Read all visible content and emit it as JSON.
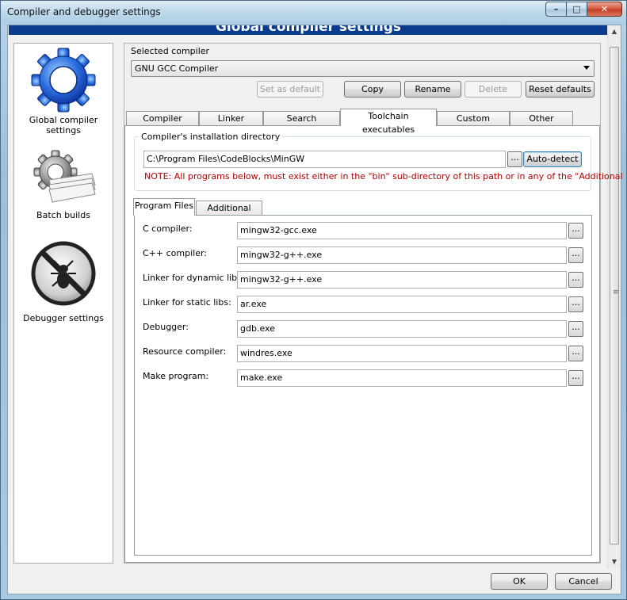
{
  "window": {
    "title": "Compiler and debugger settings",
    "min_glyph": "–",
    "max_glyph": "□",
    "close_glyph": "✕"
  },
  "banner": {
    "title": "Global compiler settings"
  },
  "sidebar": {
    "items": [
      {
        "label": "Global compiler settings",
        "icon": "gear-icon"
      },
      {
        "label": "Batch builds",
        "icon": "batch-gear-icon"
      },
      {
        "label": "Debugger settings",
        "icon": "bug-icon"
      }
    ]
  },
  "compiler": {
    "label": "Selected compiler",
    "value": "GNU GCC Compiler",
    "buttons": {
      "set_default": "Set as default",
      "copy": "Copy",
      "rename": "Rename",
      "delete": "Delete",
      "reset": "Reset defaults"
    }
  },
  "tabs": [
    "Compiler settings",
    "Linker settings",
    "Search directories",
    "Toolchain executables",
    "Custom variables",
    "Other settings"
  ],
  "active_tab": 3,
  "install_dir": {
    "group_title": "Compiler's installation directory",
    "path": "C:\\Program Files\\CodeBlocks\\MinGW",
    "browse": "...",
    "auto_detect": "Auto-detect",
    "note": "NOTE: All programs below, must exist either in the \"bin\" sub-directory of this path or in any of the \"Additional"
  },
  "subtabs": [
    "Program Files",
    "Additional Paths"
  ],
  "programs": [
    {
      "label": "C compiler:",
      "value": "mingw32-gcc.exe"
    },
    {
      "label": "C++ compiler:",
      "value": "mingw32-g++.exe"
    },
    {
      "label": "Linker for dynamic libs:",
      "value": "mingw32-g++.exe"
    },
    {
      "label": "Linker for static libs:",
      "value": "ar.exe"
    },
    {
      "label": "Debugger:",
      "value": "gdb.exe"
    },
    {
      "label": "Resource compiler:",
      "value": "windres.exe"
    },
    {
      "label": "Make program:",
      "value": "make.exe"
    }
  ],
  "dialog": {
    "ok": "OK",
    "cancel": "Cancel"
  }
}
